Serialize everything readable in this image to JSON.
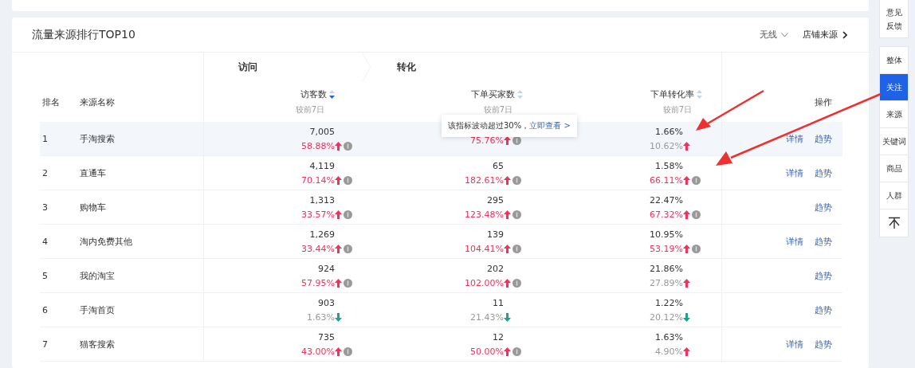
{
  "card": {
    "title": "流量来源排行TOP10",
    "filter": "无线",
    "link": "店铺来源"
  },
  "groups": [
    {
      "label": "访问"
    },
    {
      "label": "转化"
    }
  ],
  "columns": [
    {
      "label": "排名"
    },
    {
      "label": "来源名称"
    },
    {
      "label": "访客数",
      "sorted_desc": true,
      "sub": "较前7日"
    },
    {
      "label": "下单买家数",
      "sorted_desc": false,
      "sub": "较前7日"
    },
    {
      "label": "下单转化率",
      "sorted_desc": false,
      "sub": "较前7日"
    },
    {
      "label": "操作"
    }
  ],
  "tooltip": {
    "text": "该指标波动超过30%，",
    "link": "立即查看 >"
  },
  "rows": [
    {
      "rank": "1",
      "name": "手淘搜索",
      "highlighted": true,
      "metrics": [
        {
          "value": "7,005",
          "change": "58.88%",
          "rising": true,
          "alert": true
        },
        {
          "change": "75.76%",
          "rising": true,
          "alert": true
        },
        {
          "value": "1.66%",
          "change": "10.62%",
          "rising": true,
          "alert": false
        }
      ],
      "actions": [
        "详情",
        "趋势"
      ]
    },
    {
      "rank": "2",
      "name": "直通车",
      "highlighted": false,
      "metrics": [
        {
          "value": "4,119",
          "change": "70.14%",
          "rising": true,
          "alert": true
        },
        {
          "value": "65",
          "change": "182.61%",
          "rising": true,
          "alert": true
        },
        {
          "value": "1.58%",
          "change": "66.11%",
          "rising": true,
          "alert": true
        }
      ],
      "actions": [
        "详情",
        "趋势"
      ]
    },
    {
      "rank": "3",
      "name": "购物车",
      "highlighted": false,
      "metrics": [
        {
          "value": "1,313",
          "change": "33.57%",
          "rising": true,
          "alert": true
        },
        {
          "value": "295",
          "change": "123.48%",
          "rising": true,
          "alert": true
        },
        {
          "value": "22.47%",
          "change": "67.32%",
          "rising": true,
          "alert": true
        }
      ],
      "actions": [
        "趋势"
      ]
    },
    {
      "rank": "4",
      "name": "淘内免费其他",
      "highlighted": false,
      "metrics": [
        {
          "value": "1,269",
          "change": "33.44%",
          "rising": true,
          "alert": true
        },
        {
          "value": "139",
          "change": "104.41%",
          "rising": true,
          "alert": true
        },
        {
          "value": "10.95%",
          "change": "53.19%",
          "rising": true,
          "alert": true
        }
      ],
      "actions": [
        "详情",
        "趋势"
      ]
    },
    {
      "rank": "5",
      "name": "我的淘宝",
      "highlighted": false,
      "metrics": [
        {
          "value": "924",
          "change": "57.95%",
          "rising": true,
          "alert": true
        },
        {
          "value": "202",
          "change": "102.00%",
          "rising": true,
          "alert": true
        },
        {
          "value": "21.86%",
          "change": "27.89%",
          "rising": true,
          "alert": false
        }
      ],
      "actions": [
        "趋势"
      ]
    },
    {
      "rank": "6",
      "name": "手淘首页",
      "highlighted": false,
      "metrics": [
        {
          "value": "903",
          "change": "1.63%",
          "rising": false,
          "alert": false
        },
        {
          "value": "11",
          "change": "21.43%",
          "rising": false,
          "alert": false
        },
        {
          "value": "1.22%",
          "change": "20.12%",
          "rising": false,
          "alert": false
        }
      ],
      "actions": [
        "趋势"
      ]
    },
    {
      "rank": "7",
      "name": "猫客搜索",
      "highlighted": false,
      "metrics": [
        {
          "value": "735",
          "change": "43.00%",
          "rising": true,
          "alert": true
        },
        {
          "value": "12",
          "change": "50.00%",
          "rising": true,
          "alert": true
        },
        {
          "value": "1.63%",
          "change": "4.90%",
          "rising": true,
          "alert": false
        }
      ],
      "actions": [
        "详情",
        "趋势"
      ]
    }
  ],
  "sidebar": {
    "feedback": "意见反馈",
    "items": [
      {
        "label": "整体",
        "selected": false
      },
      {
        "label": "关注",
        "selected": true
      },
      {
        "label": "来源",
        "selected": false
      },
      {
        "label": "关键词",
        "selected": false
      },
      {
        "label": "商品",
        "selected": false
      },
      {
        "label": "人群",
        "selected": false
      }
    ]
  }
}
